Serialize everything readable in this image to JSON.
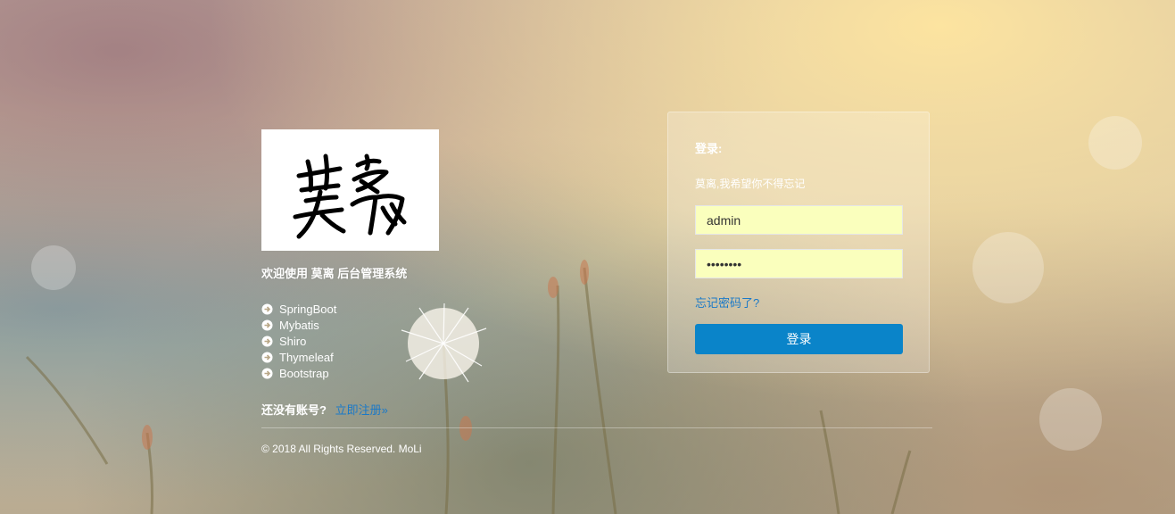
{
  "left": {
    "logo_text": "莫离",
    "welcome": "欢迎使用 莫离 后台管理系统",
    "tech_items": [
      {
        "label": "SpringBoot"
      },
      {
        "label": "Mybatis"
      },
      {
        "label": "Shiro"
      },
      {
        "label": "Thymeleaf"
      },
      {
        "label": "Bootstrap"
      }
    ],
    "register_prompt": "还没有账号?",
    "register_link": "立即注册»"
  },
  "login": {
    "title": "登录:",
    "subtitle": "莫离,我希望你不得忘记",
    "username_value": "admin",
    "password_value": "12345678",
    "forgot_link": "忘记密码了?",
    "submit_label": "登录"
  },
  "footer": {
    "copyright": "© 2018 All Rights Reserved. MoLi"
  },
  "colors": {
    "accent": "#0a84c9",
    "link": "#1a79c8",
    "autofill": "#faffbd"
  }
}
